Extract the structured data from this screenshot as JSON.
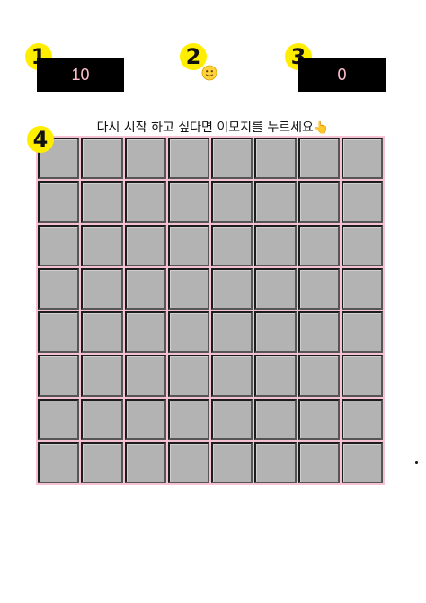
{
  "markers": [
    "1",
    "2",
    "3",
    "4"
  ],
  "mine_counter": "10",
  "face_icon": "slightly-smiling-face-icon",
  "timer": "0",
  "instruction": "다시 시작 하고 싶다면 이모지를 누르세요👆",
  "board": {
    "rows": 8,
    "cols": 8
  },
  "colors": {
    "marker": "#ffee00",
    "counter_bg": "#000000",
    "counter_text": "#ffc0cb",
    "cell": "#b3b3b3",
    "board_border": "#f4c2d2"
  }
}
